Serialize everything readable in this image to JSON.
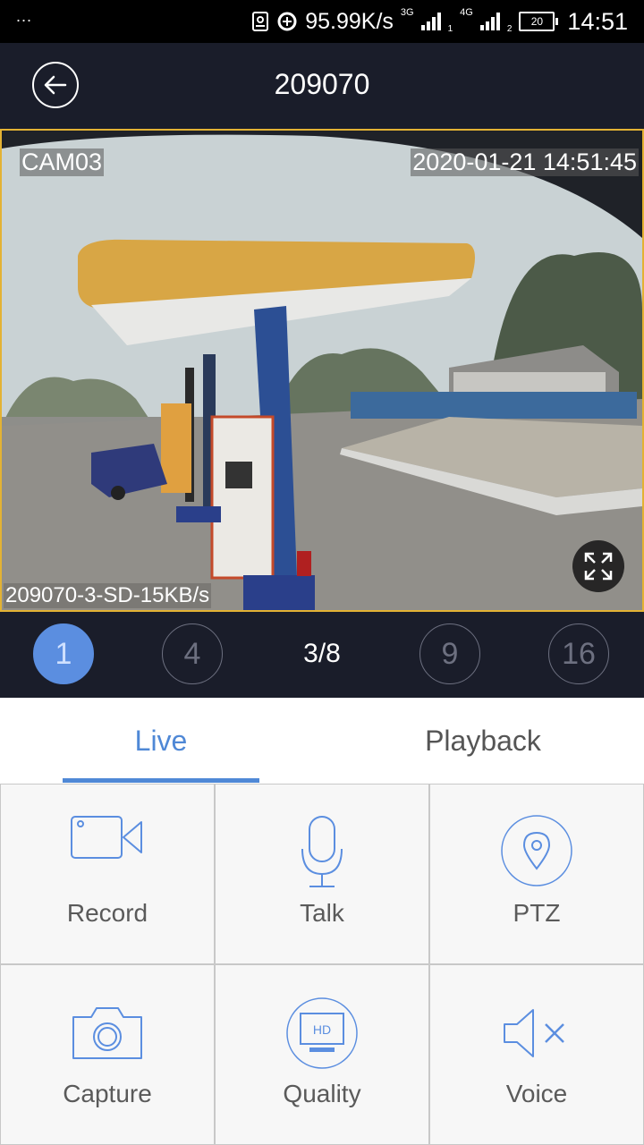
{
  "status_bar": {
    "dots": "...",
    "speed": "95.99K/s",
    "net1": "3G",
    "net1_sub": "1",
    "net2": "4G",
    "net2_sub": "2",
    "battery": "20",
    "time": "14:51"
  },
  "header": {
    "title": "209070",
    "back_icon": "arrow-left-icon"
  },
  "video": {
    "cam_label": "CAM03",
    "timestamp": "2020-01-21 14:51:45",
    "stream_info": "209070-3-SD-15KB/s",
    "border_color": "#e3b234"
  },
  "split_bar": {
    "options": [
      "1",
      "4",
      "9",
      "16"
    ],
    "selected": "1",
    "page_indicator": "3/8"
  },
  "tabs": {
    "live": "Live",
    "playback": "Playback",
    "active_color": "#4f88d6"
  },
  "actions": {
    "record": "Record",
    "talk": "Talk",
    "ptz": "PTZ",
    "capture": "Capture",
    "quality": "Quality",
    "quality_badge": "HD",
    "voice": "Voice"
  }
}
